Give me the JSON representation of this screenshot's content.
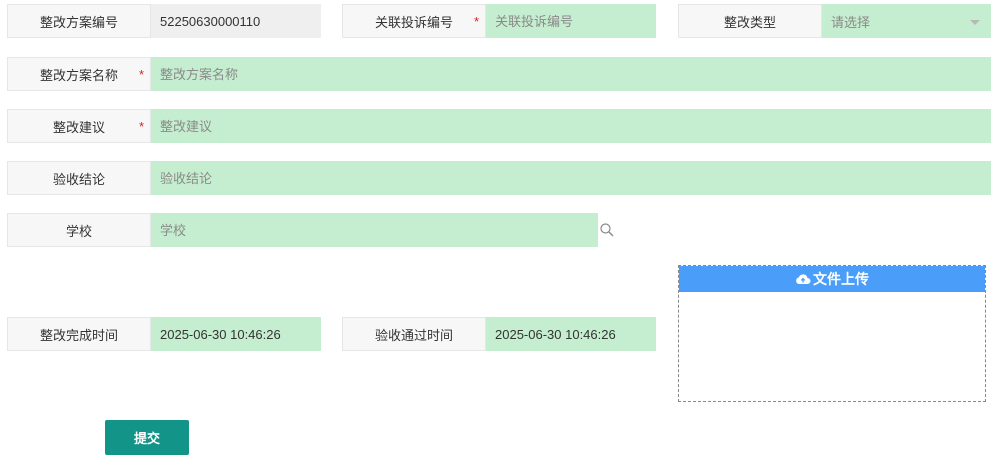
{
  "form": {
    "plan_no": {
      "label": "整改方案编号",
      "value": "52250630000110"
    },
    "complaint_no": {
      "label": "关联投诉编号",
      "placeholder": "关联投诉编号",
      "required_mark": "*"
    },
    "rectify_type": {
      "label": "整改类型",
      "placeholder": "请选择"
    },
    "plan_name": {
      "label": "整改方案名称",
      "placeholder": "整改方案名称",
      "required_mark": "*"
    },
    "suggestion": {
      "label": "整改建议",
      "placeholder": "整改建议",
      "required_mark": "*"
    },
    "acceptance": {
      "label": "验收结论",
      "placeholder": "验收结论"
    },
    "school": {
      "label": "学校",
      "placeholder": "学校"
    },
    "finish_time": {
      "label": "整改完成时间",
      "value": "2025-06-30 10:46:26"
    },
    "pass_time": {
      "label": "验收通过时间",
      "value": "2025-06-30 10:46:26"
    }
  },
  "upload": {
    "label": "文件上传"
  },
  "submit": {
    "label": "提交"
  },
  "colors": {
    "field_bg": "#c4eecf",
    "label_bg": "#f7f7f7",
    "upload_header": "#4a9df8",
    "submit_bg": "#129488",
    "required": "#e02020"
  }
}
